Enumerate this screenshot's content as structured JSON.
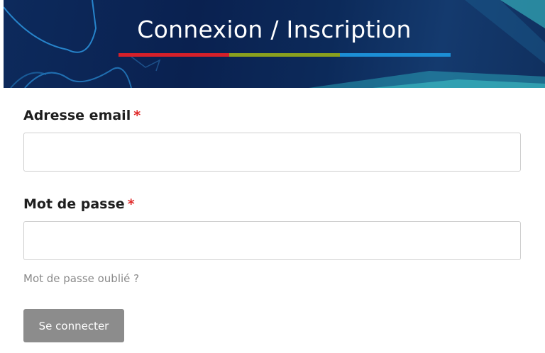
{
  "banner": {
    "title": "Connexion / Inscription",
    "accent_colors": [
      "#d6202a",
      "#8aa11e",
      "#1c8fd6"
    ]
  },
  "form": {
    "email": {
      "label": "Adresse email",
      "required_mark": "*",
      "value": "",
      "placeholder": ""
    },
    "password": {
      "label": "Mot de passe",
      "required_mark": "*",
      "value": "",
      "placeholder": ""
    },
    "forgot_link": "Mot de passe oublié ?",
    "submit_label": "Se connecter"
  }
}
